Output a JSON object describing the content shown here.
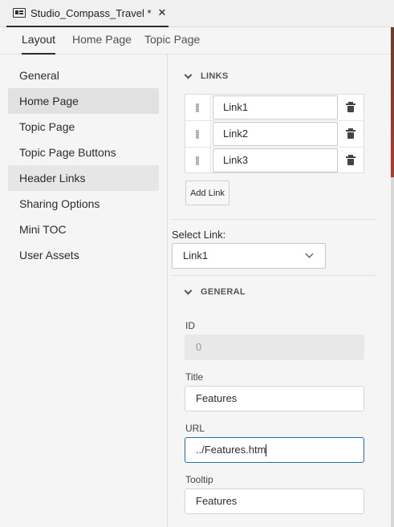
{
  "document_tab": {
    "title": "Studio_Compass_Travel *",
    "icon": "document-icon",
    "close_icon": "close-icon",
    "close_glyph": "✕"
  },
  "tabs": [
    {
      "label": "Layout",
      "active": true
    },
    {
      "label": "Home Page",
      "active": false
    },
    {
      "label": "Topic Page",
      "active": false
    }
  ],
  "sidebar": {
    "items": [
      {
        "label": "General",
        "state": "normal"
      },
      {
        "label": "Home Page",
        "state": "selected"
      },
      {
        "label": "Topic Page",
        "state": "normal"
      },
      {
        "label": "Topic Page Buttons",
        "state": "normal"
      },
      {
        "label": "Header Links",
        "state": "hovered"
      },
      {
        "label": "Sharing Options",
        "state": "normal"
      },
      {
        "label": "Mini TOC",
        "state": "normal"
      },
      {
        "label": "User Assets",
        "state": "normal"
      }
    ]
  },
  "links_section": {
    "title": "LINKS",
    "links": [
      {
        "value": "Link1"
      },
      {
        "value": "Link2"
      },
      {
        "value": "Link3"
      }
    ],
    "add_button": "Add Link"
  },
  "select_link": {
    "label": "Select Link:",
    "value": "Link1"
  },
  "general_section": {
    "title": "GENERAL",
    "id": {
      "label": "ID",
      "value": "0",
      "disabled": true
    },
    "title_field": {
      "label": "Title",
      "value": "Features"
    },
    "url": {
      "label": "URL",
      "value": "../Features.htm",
      "focused": true
    },
    "tooltip": {
      "label": "Tooltip",
      "value": "Features"
    }
  },
  "colors": {
    "background": "#f5f5f5",
    "selected_item": "#e1e1e1",
    "focus_border": "#1f6fb8",
    "disabled_field": "#e8e8e8"
  }
}
